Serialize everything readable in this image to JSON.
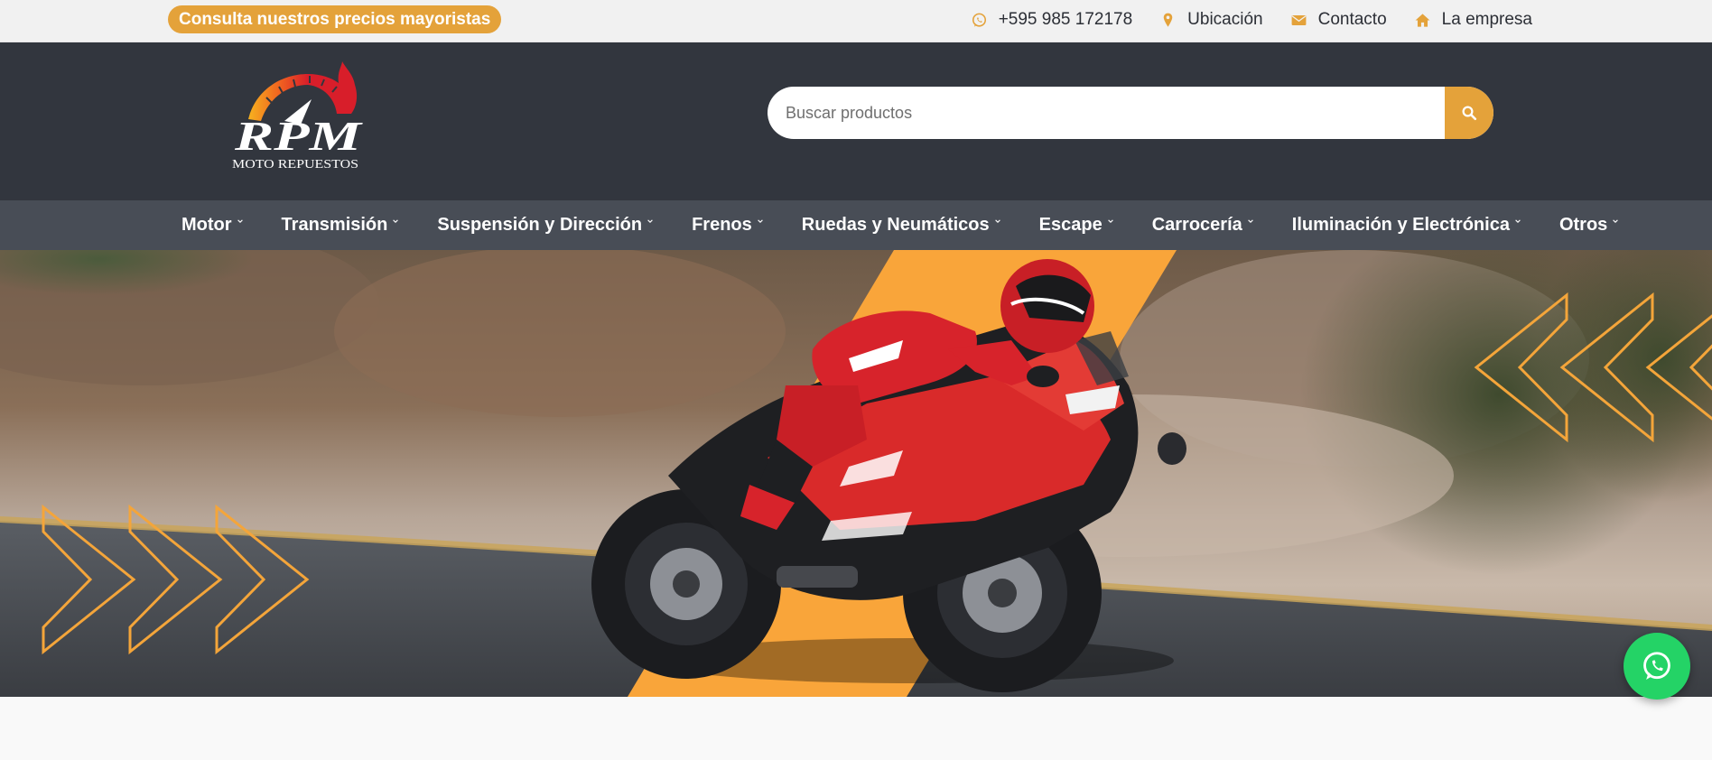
{
  "topbar": {
    "promo": "Consulta nuestros precios mayoristas",
    "links": [
      {
        "icon": "whatsapp-icon",
        "label": "+595 985 172178"
      },
      {
        "icon": "map-marker-icon",
        "label": "Ubicación"
      },
      {
        "icon": "envelope-icon",
        "label": "Contacto"
      },
      {
        "icon": "home-icon",
        "label": "La empresa"
      }
    ]
  },
  "header": {
    "logo": {
      "brand": "RPM",
      "tagline": "MOTO REPUESTOS"
    },
    "search": {
      "placeholder": "Buscar productos",
      "value": ""
    }
  },
  "nav": {
    "items": [
      {
        "label": "Motor"
      },
      {
        "label": "Transmisión"
      },
      {
        "label": "Suspensión y Dirección"
      },
      {
        "label": "Frenos"
      },
      {
        "label": "Ruedas y Neumáticos"
      },
      {
        "label": "Escape"
      },
      {
        "label": "Carrocería"
      },
      {
        "label": "Iluminación y Electrónica"
      },
      {
        "label": "Otros"
      }
    ]
  },
  "hero": {
    "image": "motorcycle-rider-banner"
  },
  "colors": {
    "accent": "#e4a23a",
    "header": "#32363e",
    "nav": "#484d56",
    "whatsapp": "#24d366"
  }
}
